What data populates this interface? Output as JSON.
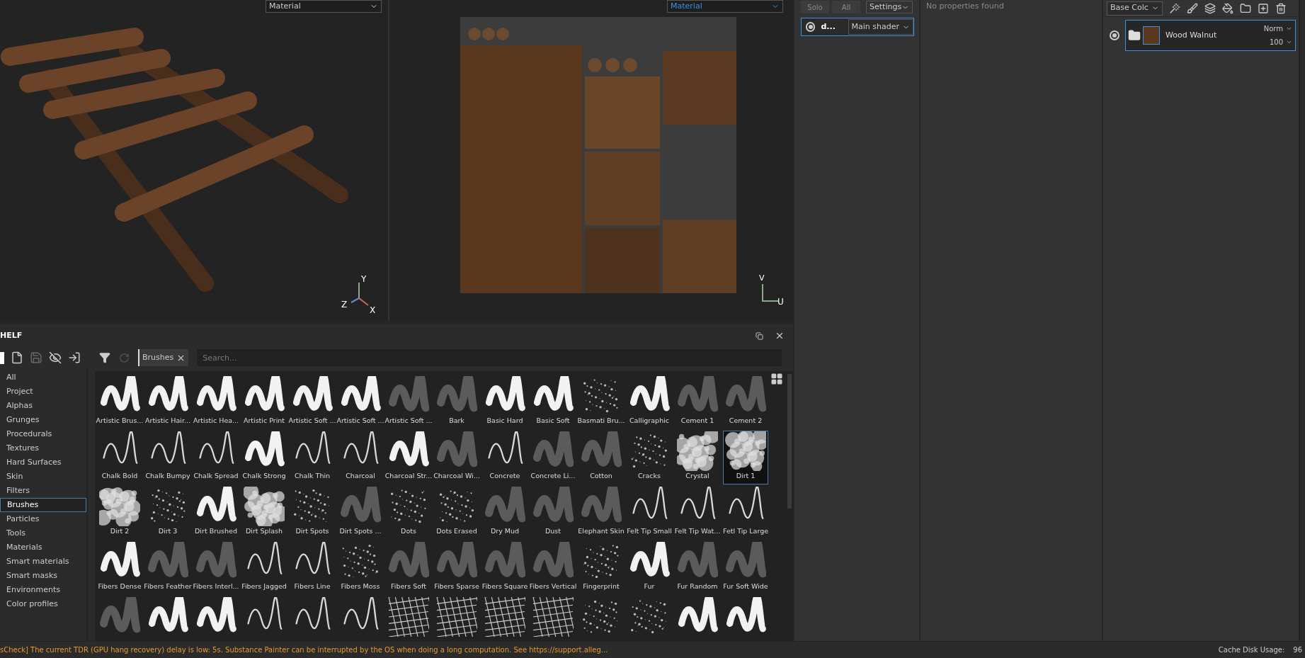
{
  "viewport_3d": {
    "material_dropdown": "Material",
    "axis": {
      "y": "Y",
      "z": "Z",
      "x": "X"
    }
  },
  "viewport_uv": {
    "material_dropdown": "Material",
    "axis": {
      "v": "V",
      "u": "U"
    }
  },
  "texture_sets": {
    "buttons": [
      {
        "label": "Solo",
        "disabled": true
      },
      {
        "label": "All",
        "disabled": true
      }
    ],
    "settings": "Settings",
    "items": [
      {
        "name": "d...",
        "visible": true,
        "selected": true,
        "shader": "Main shader"
      }
    ]
  },
  "properties": {
    "message": "No properties found"
  },
  "layers": {
    "channel": "Base Colc",
    "items": [
      {
        "name": "Wood Walnut",
        "visible": true,
        "selected": true,
        "blend": "Norm",
        "opacity": "100"
      }
    ]
  },
  "shelf": {
    "title": "HELF",
    "filter_tag": "Brushes",
    "search_placeholder": "Search...",
    "categories": [
      {
        "label": "All",
        "selected": false
      },
      {
        "label": "Project",
        "selected": false
      },
      {
        "label": "Alphas",
        "selected": false
      },
      {
        "label": "Grunges",
        "selected": false
      },
      {
        "label": "Procedurals",
        "selected": false
      },
      {
        "label": "Textures",
        "selected": false
      },
      {
        "label": "Hard Surfaces",
        "selected": false
      },
      {
        "label": "Skin",
        "selected": false
      },
      {
        "label": "Filters",
        "selected": false
      },
      {
        "label": "Brushes",
        "selected": true
      },
      {
        "label": "Particles",
        "selected": false
      },
      {
        "label": "Tools",
        "selected": false
      },
      {
        "label": "Materials",
        "selected": false
      },
      {
        "label": "Smart materials",
        "selected": false
      },
      {
        "label": "Smart masks",
        "selected": false
      },
      {
        "label": "Environments",
        "selected": false
      },
      {
        "label": "Color profiles",
        "selected": false
      }
    ],
    "assets": [
      {
        "label": "Artistic Brus...",
        "kind": "stroke",
        "selected": false
      },
      {
        "label": "Artistic Hair...",
        "kind": "stroke",
        "selected": false
      },
      {
        "label": "Artistic Hea...",
        "kind": "stroke",
        "selected": false
      },
      {
        "label": "Artistic Print",
        "kind": "stroke",
        "selected": false
      },
      {
        "label": "Artistic Soft ...",
        "kind": "stroke",
        "selected": false
      },
      {
        "label": "Artistic Soft ...",
        "kind": "stroke",
        "selected": false
      },
      {
        "label": "Artistic Soft ...",
        "kind": "soft",
        "selected": false
      },
      {
        "label": "Bark",
        "kind": "soft",
        "selected": false
      },
      {
        "label": "Basic Hard",
        "kind": "stroke",
        "selected": false
      },
      {
        "label": "Basic Soft",
        "kind": "stroke",
        "selected": false
      },
      {
        "label": "Basmati Bru...",
        "kind": "speckle",
        "selected": false
      },
      {
        "label": "Calligraphic",
        "kind": "stroke",
        "selected": false
      },
      {
        "label": "Cement 1",
        "kind": "soft",
        "selected": false
      },
      {
        "label": "Cement 2",
        "kind": "soft",
        "selected": false
      },
      {
        "label": "Chalk Bold",
        "kind": "thin",
        "selected": false
      },
      {
        "label": "Chalk Bumpy",
        "kind": "thin",
        "selected": false
      },
      {
        "label": "Chalk Spread",
        "kind": "thin",
        "selected": false
      },
      {
        "label": "Chalk Strong",
        "kind": "stroke",
        "selected": false
      },
      {
        "label": "Chalk Thin",
        "kind": "thin",
        "selected": false
      },
      {
        "label": "Charcoal",
        "kind": "thin",
        "selected": false
      },
      {
        "label": "Charcoal Str...",
        "kind": "stroke",
        "selected": false
      },
      {
        "label": "Charcoal Wi...",
        "kind": "soft",
        "selected": false
      },
      {
        "label": "Concrete",
        "kind": "thin",
        "selected": false
      },
      {
        "label": "Concrete Li...",
        "kind": "soft",
        "selected": false
      },
      {
        "label": "Cotton",
        "kind": "soft",
        "selected": false
      },
      {
        "label": "Cracks",
        "kind": "speckle",
        "selected": false
      },
      {
        "label": "Crystal",
        "kind": "cloud",
        "selected": false
      },
      {
        "label": "Dirt 1",
        "kind": "cloud",
        "selected": true
      },
      {
        "label": "Dirt 2",
        "kind": "cloud",
        "selected": false
      },
      {
        "label": "Dirt 3",
        "kind": "speckle",
        "selected": false
      },
      {
        "label": "Dirt Brushed",
        "kind": "stroke",
        "selected": false
      },
      {
        "label": "Dirt Splash",
        "kind": "cloud",
        "selected": false
      },
      {
        "label": "Dirt Spots",
        "kind": "speckle",
        "selected": false
      },
      {
        "label": "Dirt Spots ...",
        "kind": "soft",
        "selected": false
      },
      {
        "label": "Dots",
        "kind": "speckle",
        "selected": false
      },
      {
        "label": "Dots Erased",
        "kind": "speckle",
        "selected": false
      },
      {
        "label": "Dry Mud",
        "kind": "soft",
        "selected": false
      },
      {
        "label": "Dust",
        "kind": "soft",
        "selected": false
      },
      {
        "label": "Elephant Skin",
        "kind": "soft",
        "selected": false
      },
      {
        "label": "Felt Tip Small",
        "kind": "thin",
        "selected": false
      },
      {
        "label": "Felt Tip Wat...",
        "kind": "thin",
        "selected": false
      },
      {
        "label": "Fetl Tip Large",
        "kind": "thin",
        "selected": false
      },
      {
        "label": "Fibers Dense",
        "kind": "stroke",
        "selected": false
      },
      {
        "label": "Fibers Feather",
        "kind": "soft",
        "selected": false
      },
      {
        "label": "Fibers Interl...",
        "kind": "soft",
        "selected": false
      },
      {
        "label": "Fibers Jagged",
        "kind": "thin",
        "selected": false
      },
      {
        "label": "Fibers Line",
        "kind": "thin",
        "selected": false
      },
      {
        "label": "Fibers Moss",
        "kind": "speckle",
        "selected": false
      },
      {
        "label": "Fibers Soft",
        "kind": "soft",
        "selected": false
      },
      {
        "label": "Fibers Sparse",
        "kind": "soft",
        "selected": false
      },
      {
        "label": "Fibers Square",
        "kind": "soft",
        "selected": false
      },
      {
        "label": "Fibers Vertical",
        "kind": "soft",
        "selected": false
      },
      {
        "label": "Fingerprint",
        "kind": "speckle",
        "selected": false
      },
      {
        "label": "Fur",
        "kind": "stroke",
        "selected": false
      },
      {
        "label": "Fur Random",
        "kind": "soft",
        "selected": false
      },
      {
        "label": "Fur Soft Wide",
        "kind": "soft",
        "selected": false
      },
      {
        "kind": "soft",
        "selected": false
      },
      {
        "kind": "stroke",
        "selected": false
      },
      {
        "kind": "stroke",
        "selected": false
      },
      {
        "kind": "thin",
        "selected": false
      },
      {
        "kind": "thin",
        "selected": false
      },
      {
        "kind": "thin",
        "selected": false
      },
      {
        "kind": "pattern",
        "selected": false
      },
      {
        "kind": "pattern",
        "selected": false
      },
      {
        "kind": "pattern",
        "selected": false
      },
      {
        "kind": "pattern",
        "selected": false
      },
      {
        "kind": "speckle",
        "selected": false
      },
      {
        "kind": "speckle",
        "selected": false
      },
      {
        "kind": "stroke",
        "selected": false
      },
      {
        "kind": "stroke",
        "selected": false
      }
    ]
  },
  "status_bar": {
    "message": "sCheck] The current TDR (GPU hang recovery) delay is low: 5s. Substance Painter can be interrupted by the OS when doing a long computation. See https://support.alleg...",
    "cache_label": "Cache Disk Usage:",
    "cache_value": "96"
  }
}
